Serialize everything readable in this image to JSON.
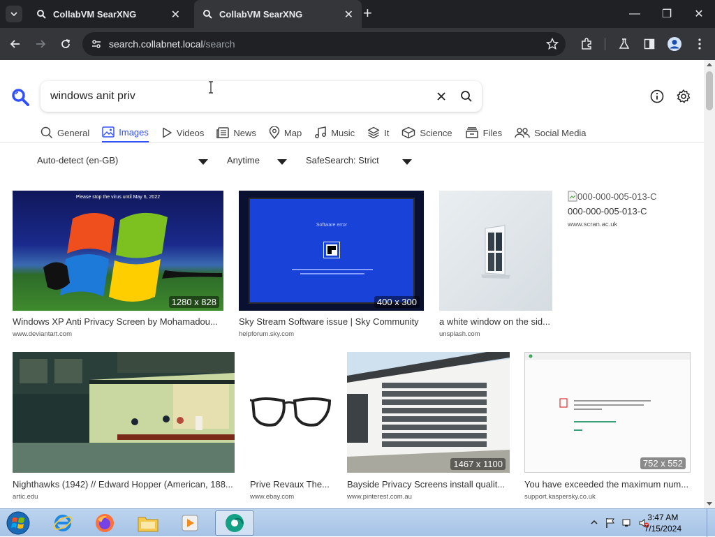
{
  "browser": {
    "tabs": [
      {
        "title": "CollabVM SearXNG"
      },
      {
        "title": "CollabVM SearXNG"
      }
    ],
    "url_host": "search.collabnet.local",
    "url_path": "/search"
  },
  "search": {
    "query": "windows anit priv"
  },
  "categories": [
    {
      "label": "General",
      "icon": "search-icon"
    },
    {
      "label": "Images",
      "icon": "image-icon",
      "active": true
    },
    {
      "label": "Videos",
      "icon": "play-icon"
    },
    {
      "label": "News",
      "icon": "newspaper-icon"
    },
    {
      "label": "Map",
      "icon": "pin-icon"
    },
    {
      "label": "Music",
      "icon": "music-icon"
    },
    {
      "label": "It",
      "icon": "layers-icon"
    },
    {
      "label": "Science",
      "icon": "cube-icon"
    },
    {
      "label": "Files",
      "icon": "files-icon"
    },
    {
      "label": "Social Media",
      "icon": "people-icon"
    }
  ],
  "filters": {
    "language": "Auto-detect (en-GB)",
    "time": "Anytime",
    "safesearch": "SafeSearch: Strict"
  },
  "results": [
    {
      "title": "Windows XP Anti Privacy Screen by Mohamadou...",
      "source": "www.deviantart.com",
      "dims": "1280 x 828",
      "caption": "Please stop the virus until May 6, 2022"
    },
    {
      "title": "Sky Stream Software issue | Sky Community",
      "source": "helpforum.sky.com",
      "dims": "400 x 300",
      "caption": "Software error"
    },
    {
      "title": "a white window on the sid...",
      "source": "unsplash.com",
      "dims": ""
    },
    {
      "title": "000-000-005-013-C",
      "source": "www.scran.ac.uk",
      "dims": "",
      "alt": "000-000-005-013-C"
    },
    {
      "title": "Nighthawks (1942) // Edward Hopper (American, 188...",
      "source": "artic.edu",
      "dims": ""
    },
    {
      "title": "Prive Revaux The...",
      "source": "www.ebay.com",
      "dims": ""
    },
    {
      "title": "Bayside Privacy Screens install qualit...",
      "source": "www.pinterest.com.au",
      "dims": "1467 x 1100"
    },
    {
      "title": "You have exceeded the maximum num...",
      "source": "support.kaspersky.co.uk",
      "dims": "752 x 552"
    }
  ],
  "taskbar": {
    "time": "3:47 AM",
    "date": "7/15/2024"
  }
}
